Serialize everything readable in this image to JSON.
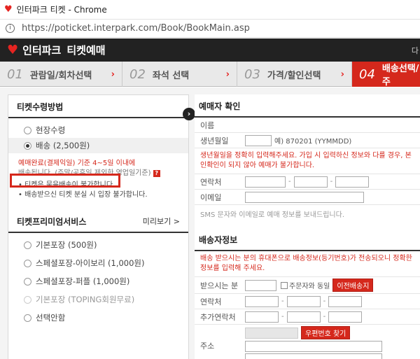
{
  "window": {
    "title": "인터파크 티켓 - Chrome",
    "url": "https://poticket.interpark.com/Book/BookMain.asp"
  },
  "site": {
    "logo": "인터파크",
    "logo_sub": "티켓예매",
    "header_right": "다"
  },
  "steps": [
    {
      "num": "01",
      "label": "관람일/회차선택"
    },
    {
      "num": "02",
      "label": "좌석 선택"
    },
    {
      "num": "03",
      "label": "가격/할인선택"
    },
    {
      "num": "04",
      "label": "배송선택/주"
    }
  ],
  "left": {
    "receive_title": "티켓수령방법",
    "receive_options": [
      "현장수령",
      "배송 (2,500원)"
    ],
    "notice_red": "예매완료(결제익일) 기준 4~5일 이내에",
    "notice_gray": "배송됩니다. (주말/공휴일 제외한 영업일기준)",
    "qmark": "?",
    "bullet1": "• 티켓은 묶음배송이 불가합니다.",
    "bullet2": "• 배송받으신 티켓 분실 시 입장 불가합니다.",
    "premium_title": "티켓프리미엄서비스",
    "premium_more": "미리보기 >",
    "premium_options": [
      "기본포장 (500원)",
      "스페셜포장-아이보리 (1,000원)",
      "스페셜포장-퍼플 (1,000원)",
      "기본포장 (TOPING회원무료)",
      "선택안함"
    ]
  },
  "right": {
    "buyer_title": "예매자 확인",
    "name_label": "이름",
    "birth_label": "생년월일",
    "birth_hint": "예) 870201 (YYMMDD)",
    "birth_notice": "생년월일을 정확히 입력해주세요. 가입 시 입력하신 정보와 다를 경우, 본인확인이 되지 않아 예매가 불가합니다.",
    "phone_label": "연락처",
    "email_label": "이메일",
    "sms_notice": "SMS 문자와 이메일로 예매 정보를 보내드립니다.",
    "delivery_title": "배송자정보",
    "delivery_notice": "배송 받으시는 분의 휴대폰으로 배송정보(등기번호)가 전송되오니 정확한 정보를 입력해 주세요.",
    "receiver_label": "받으시는 분",
    "same_label": "주문자와 동일",
    "prev_btn": "이전배송지",
    "d_phone_label": "연락처",
    "d_phone2_label": "추가연락처",
    "addr_label": "주소",
    "zip_btn": "우편번호 찾기"
  },
  "dash": "-"
}
